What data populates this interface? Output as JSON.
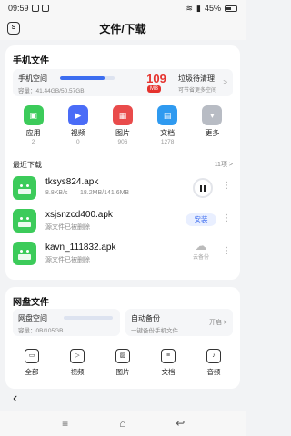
{
  "status_bar": {
    "time": "09:59",
    "battery": "45%"
  },
  "header": {
    "title": "文件/下载",
    "back_box": "S"
  },
  "local": {
    "title": "手机文件",
    "space": {
      "name": "手机空间",
      "usage": "容量：41.44GB/50.57GB",
      "fill_fraction": 0.82
    },
    "junk": {
      "value": "109",
      "unit": "MB",
      "title": "垃圾待清理",
      "subtitle": "可节省更多空间"
    },
    "categories": [
      {
        "label": "应用",
        "count": "2",
        "color": "#3ccb5a",
        "icon": "android-icon",
        "glyph": "▣"
      },
      {
        "label": "视频",
        "count": "0",
        "color": "#4a6cf7",
        "icon": "video-icon",
        "glyph": "▶"
      },
      {
        "label": "图片",
        "count": "906",
        "color": "#e94b4b",
        "icon": "image-icon",
        "glyph": "▦"
      },
      {
        "label": "文档",
        "count": "1278",
        "color": "#2f9af0",
        "icon": "document-icon",
        "glyph": "▤"
      },
      {
        "label": "更多",
        "count": "",
        "color": "#b8bcc4",
        "icon": "more-icon",
        "glyph": "▾"
      }
    ],
    "recent": {
      "title": "最近下载",
      "count": "11项 >",
      "files": [
        {
          "name": "tksys824.apk",
          "speed": "8.8KB/s",
          "progress": "18.2MB/141.6MB",
          "action": "pause"
        },
        {
          "name": "xsjsnzcd400.apk",
          "note": "源文件已被删除",
          "action": "安装"
        },
        {
          "name": "kavn_111832.apk",
          "note": "源文件已被删除",
          "action": "云备份"
        }
      ]
    }
  },
  "remote": {
    "title": "网盘文件",
    "space": {
      "name": "网盘空间",
      "usage": "容量：0B/105GB"
    },
    "backup": {
      "name": "自动备份",
      "subtitle": "一键备份手机文件",
      "state": "开启 >"
    },
    "tools": [
      {
        "label": "全部",
        "icon": "folder-icon",
        "glyph": "▭"
      },
      {
        "label": "视频",
        "icon": "video-icon",
        "glyph": "▷"
      },
      {
        "label": "图片",
        "icon": "image-icon",
        "glyph": "▨"
      },
      {
        "label": "文档",
        "icon": "document-icon",
        "glyph": "≡"
      },
      {
        "label": "音频",
        "icon": "audio-icon",
        "glyph": "♪"
      }
    ]
  }
}
